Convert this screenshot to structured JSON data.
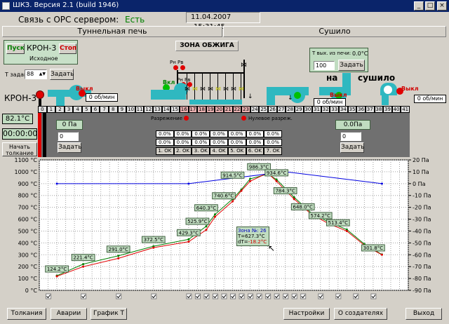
{
  "window": {
    "title": "ШКЗ. Версия 2.1 (build 1946)"
  },
  "header": {
    "opc_label": "Связь с OPC сервером:",
    "opc_status": "Есть",
    "date": "11.04.2007",
    "time": "15:31:45"
  },
  "tabs": [
    {
      "label": "Туннельная печь"
    },
    {
      "label": "Сушило"
    }
  ],
  "left_panel": {
    "start_label": "Пуск",
    "stop_label": "Стоп",
    "device_name": "КРОН-3",
    "device_state": "Исходное",
    "t_set_label": "Т задан:",
    "t_set_value": "88",
    "set_label": "Задать",
    "kron_label": "КРОН-3",
    "off_label": "Выкл",
    "rpm_left": "0 об/мин",
    "temperature": "82.1°C",
    "timer": "00:00:00",
    "start_push": "Начать толкание"
  },
  "center": {
    "zone_title": "ЗОНА ОБЖИГА",
    "on_label": "Вкл",
    "rn_rv_top": "Рн Рв",
    "rn_rv_mid": "Рн Рв",
    "razrezhenie": "Разрежение",
    "null_razrezh": "Нулевое разреж.",
    "pressure_left": "0 Па",
    "pressure_left_input": "0",
    "set_left": "Задать",
    "burners": [
      {
        "pct": "0.0%",
        "pct2": "0.0%",
        "ok": "1. OK"
      },
      {
        "pct": "0.0%",
        "pct2": "0.0%",
        "ok": "2. OK"
      },
      {
        "pct": "0.0%",
        "pct2": "0.0%",
        "ok": "3. OK"
      },
      {
        "pct": "0.0%",
        "pct2": "0.0%",
        "ok": "4. OK"
      },
      {
        "pct": "0.0%",
        "pct2": "0.0%",
        "ok": "5. OK"
      },
      {
        "pct": "0.0%",
        "pct2": "0.0%",
        "ok": "6. OK"
      },
      {
        "pct": "0.0%",
        "pct2": "0.0%",
        "ok": "7. OK"
      }
    ]
  },
  "right_panel": {
    "t_out_label": "Т вых. из печи:",
    "t_out_value": "0.0°C",
    "t_out_input": "100",
    "set_label": "Задать",
    "na_sushilo_a": "на",
    "na_sushilo_b": "сушило",
    "off_label": "Выкл",
    "off_label2": "Выкл",
    "rpm_mid": "0 об/мин",
    "rpm_right": "0 об/мин",
    "pressure_right": "0.0Па",
    "pressure_right_input": "0",
    "set_right": "Задать"
  },
  "positions": [
    "0",
    "1",
    "2",
    "3",
    "4",
    "5",
    "6",
    "7",
    "8",
    "9",
    "10",
    "11",
    "12",
    "13",
    "14",
    "15",
    "16",
    "17",
    "18",
    "19",
    "20",
    "21",
    "22",
    "23",
    "24",
    "25",
    "26",
    "27",
    "28",
    "29",
    "30",
    "31",
    "32",
    "33",
    "34",
    "35",
    "36",
    "37",
    "38",
    "39",
    "40",
    "41"
  ],
  "chart_data": {
    "type": "line",
    "x": [
      1,
      2,
      3,
      4,
      5,
      6,
      7,
      8,
      9,
      10,
      11,
      12,
      13,
      14,
      15,
      16,
      17,
      18,
      19,
      20,
      21,
      22,
      23,
      24,
      25,
      26,
      27,
      28,
      29,
      30,
      31,
      32,
      33,
      34,
      35,
      36,
      37,
      38,
      39,
      40,
      41
    ],
    "y_left_ticks": [
      "1100 °C",
      "1000 °C",
      "900 °C",
      "800 °C",
      "700 °C",
      "600 °C",
      "500 °C",
      "400 °C",
      "300 °C",
      "200 °C",
      "100 °C",
      "0 °C"
    ],
    "y_right_ticks": [
      "20 Па",
      "10 Па",
      "0 Па",
      "-10 Па",
      "-20 Па",
      "-30 Па",
      "-40 Па",
      "-50 Па",
      "-60 Па",
      "-70 Па",
      "-80 Па",
      "-90 Па"
    ],
    "ylim": [
      0,
      1100
    ],
    "ylim_right": [
      -90,
      20
    ],
    "series": [
      {
        "color": "#008000",
        "points": [
          [
            2,
            124
          ],
          [
            5,
            221
          ],
          [
            9,
            291
          ],
          [
            13,
            372
          ],
          [
            17,
            430
          ],
          [
            19,
            540
          ],
          [
            20,
            640
          ],
          [
            22,
            770
          ],
          [
            23,
            850
          ],
          [
            24,
            940
          ],
          [
            26,
            980
          ],
          [
            27,
            935
          ],
          [
            29,
            785
          ],
          [
            31,
            650
          ],
          [
            33,
            574
          ],
          [
            35,
            513
          ],
          [
            37,
            390
          ],
          [
            39,
            302
          ]
        ]
      },
      {
        "color": "#e00000",
        "points": [
          [
            2,
            118
          ],
          [
            5,
            200
          ],
          [
            9,
            270
          ],
          [
            13,
            360
          ],
          [
            17,
            410
          ],
          [
            19,
            510
          ],
          [
            20,
            620
          ],
          [
            22,
            750
          ],
          [
            23,
            840
          ],
          [
            24,
            920
          ],
          [
            26,
            990
          ],
          [
            27,
            920
          ],
          [
            29,
            770
          ],
          [
            31,
            640
          ],
          [
            33,
            560
          ],
          [
            35,
            500
          ],
          [
            37,
            380
          ],
          [
            39,
            300
          ]
        ]
      },
      {
        "color": "#0000e0",
        "points": [
          [
            2,
            0
          ],
          [
            17,
            0
          ],
          [
            28,
            10
          ],
          [
            39,
            0
          ]
        ]
      }
    ],
    "labels": [
      {
        "x": 2,
        "y": 124,
        "text": "124.2°C"
      },
      {
        "x": 5,
        "y": 221,
        "text": "221.4°C"
      },
      {
        "x": 9,
        "y": 291,
        "text": "291.0°C"
      },
      {
        "x": 13,
        "y": 372,
        "text": "372.5°C"
      },
      {
        "x": 17,
        "y": 430,
        "text": "429.3°C"
      },
      {
        "x": 18,
        "y": 526,
        "text": "525.9°C"
      },
      {
        "x": 19,
        "y": 640,
        "text": "640.3°C"
      },
      {
        "x": 21,
        "y": 741,
        "text": "740.6°C"
      },
      {
        "x": 22,
        "y": 915,
        "text": "914.5°C"
      },
      {
        "x": 25,
        "y": 986,
        "text": "986.3°C"
      },
      {
        "x": 27,
        "y": 935,
        "text": "934.6°C"
      },
      {
        "x": 28,
        "y": 784,
        "text": "784.3°C"
      },
      {
        "x": 30,
        "y": 648,
        "text": "648.0°C"
      },
      {
        "x": 32,
        "y": 574,
        "text": "574.2°C"
      },
      {
        "x": 34,
        "y": 514,
        "text": "513.4°C"
      },
      {
        "x": 38,
        "y": 302,
        "text": "301.8°C"
      }
    ],
    "tooltip": {
      "zone": "Зона №: 26",
      "t": "Т=627.3°C",
      "dt_label": "dT=",
      "dt": "-18.2°C"
    }
  },
  "footer": {
    "buttons": [
      {
        "label": "Толкания"
      },
      {
        "label": "Аварии"
      },
      {
        "label": "График Т"
      },
      {
        "label": "Настройки"
      },
      {
        "label": "О создателях"
      },
      {
        "label": "Выход"
      }
    ]
  }
}
